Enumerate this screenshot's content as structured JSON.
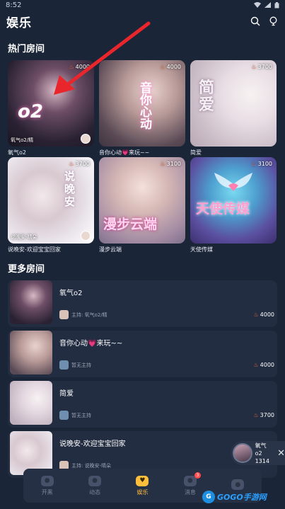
{
  "status_bar": {
    "time": "8:52"
  },
  "header": {
    "title": "娱乐",
    "search_icon": "search-icon",
    "lightbulb_icon": "lightbulb-icon"
  },
  "hot_section": {
    "title": "热门房间",
    "rooms": [
      {
        "name": "氧气o2",
        "heat": "4000",
        "subtitle": "氧气o2/精",
        "overlay": "o2"
      },
      {
        "name": "音你心动💗来玩~~",
        "heat": "4000",
        "subtitle": "",
        "overlay": "音你心动"
      },
      {
        "name": "简爱",
        "heat": "3700",
        "subtitle": "",
        "overlay": "简爱"
      },
      {
        "name": "说晚安-欢迎宝宝回家",
        "heat": "3700",
        "subtitle": "说晚安-晴朵",
        "overlay": "说晚安"
      },
      {
        "name": "漫步云端",
        "heat": "3100",
        "subtitle": "",
        "overlay": "漫步云端"
      },
      {
        "name": "天使传媒",
        "heat": "3100",
        "subtitle": "",
        "overlay": "天使传媒"
      }
    ]
  },
  "more_section": {
    "title": "更多房间",
    "rooms": [
      {
        "name": "氧气o2",
        "host": "主持: 氧气o2/精",
        "heat": "4000"
      },
      {
        "name": "音你心动💗来玩~~",
        "host": "暂无主持",
        "heat": "4000"
      },
      {
        "name": "简爱",
        "host": "暂无主持",
        "heat": "3700"
      },
      {
        "name": "说晚安-欢迎宝宝回家",
        "host": "主持: 说晚安-晴朵",
        "heat": ""
      }
    ]
  },
  "mini_player": {
    "name": "氧气o2",
    "id": "1314"
  },
  "bottom_nav": {
    "tabs": [
      {
        "label": "开黑",
        "icon": "gamepad-icon"
      },
      {
        "label": "动态",
        "icon": "chat-icon"
      },
      {
        "label": "娱乐",
        "icon": "heart-icon"
      },
      {
        "label": "消息",
        "icon": "message-icon"
      },
      {
        "label": "",
        "icon": "profile-icon"
      }
    ],
    "message_badge": "3"
  },
  "watermark": {
    "text": "GOGO手游网",
    "logo": "G"
  },
  "colors": {
    "background": "#1b2538",
    "accent": "#ffbf3d",
    "flame": "#ff6a3c",
    "row_bg": "#222d41"
  }
}
